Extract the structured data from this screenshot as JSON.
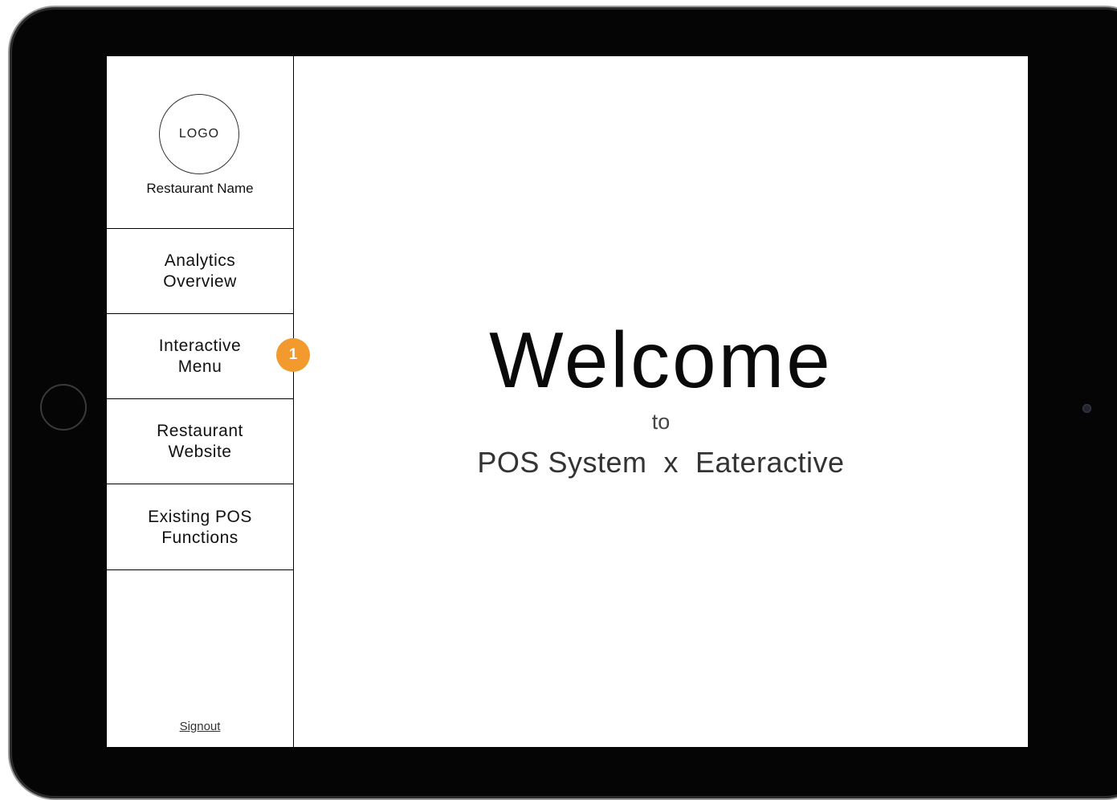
{
  "sidebar": {
    "logo_text": "LOGO",
    "restaurant_name": "Restaurant Name",
    "items": [
      {
        "line1": "Analytics",
        "line2": "Overview"
      },
      {
        "line1": "Interactive",
        "line2": "Menu"
      },
      {
        "line1": "Restaurant",
        "line2": "Website"
      },
      {
        "line1": "Existing POS",
        "line2": "Functions"
      }
    ],
    "signout_label": "Signout"
  },
  "badge": {
    "number": "1",
    "color": "#f29a2e"
  },
  "main": {
    "welcome": "Welcome",
    "to": "to",
    "system_line": "POS System  x  Eateractive"
  }
}
